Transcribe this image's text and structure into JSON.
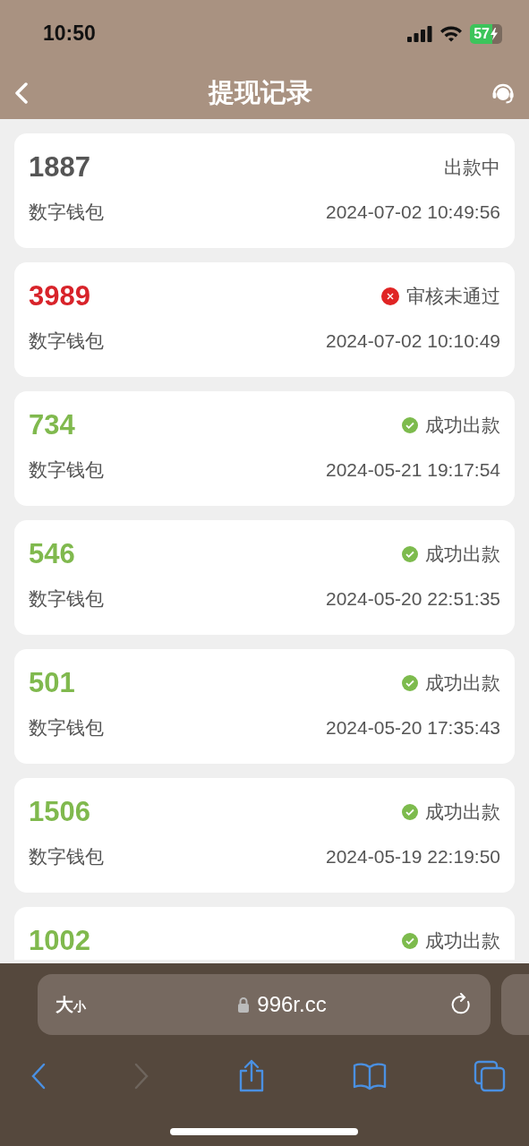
{
  "status_bar": {
    "time": "10:50",
    "battery": "57"
  },
  "header": {
    "title": "提现记录"
  },
  "records": [
    {
      "amount": "1887",
      "kind": "pending",
      "status_text": "出款中",
      "method": "数字钱包",
      "time": "2024-07-02 10:49:56"
    },
    {
      "amount": "3989",
      "kind": "rejected",
      "status_text": "审核未通过",
      "method": "数字钱包",
      "time": "2024-07-02 10:10:49"
    },
    {
      "amount": "734",
      "kind": "success",
      "status_text": "成功出款",
      "method": "数字钱包",
      "time": "2024-05-21 19:17:54"
    },
    {
      "amount": "546",
      "kind": "success",
      "status_text": "成功出款",
      "method": "数字钱包",
      "time": "2024-05-20 22:51:35"
    },
    {
      "amount": "501",
      "kind": "success",
      "status_text": "成功出款",
      "method": "数字钱包",
      "time": "2024-05-20 17:35:43"
    },
    {
      "amount": "1506",
      "kind": "success",
      "status_text": "成功出款",
      "method": "数字钱包",
      "time": "2024-05-19 22:19:50"
    },
    {
      "amount": "1002",
      "kind": "success",
      "status_text": "成功出款"
    }
  ],
  "browser": {
    "text_size_big": "大",
    "text_size_small": "小",
    "url": "996r.cc"
  }
}
